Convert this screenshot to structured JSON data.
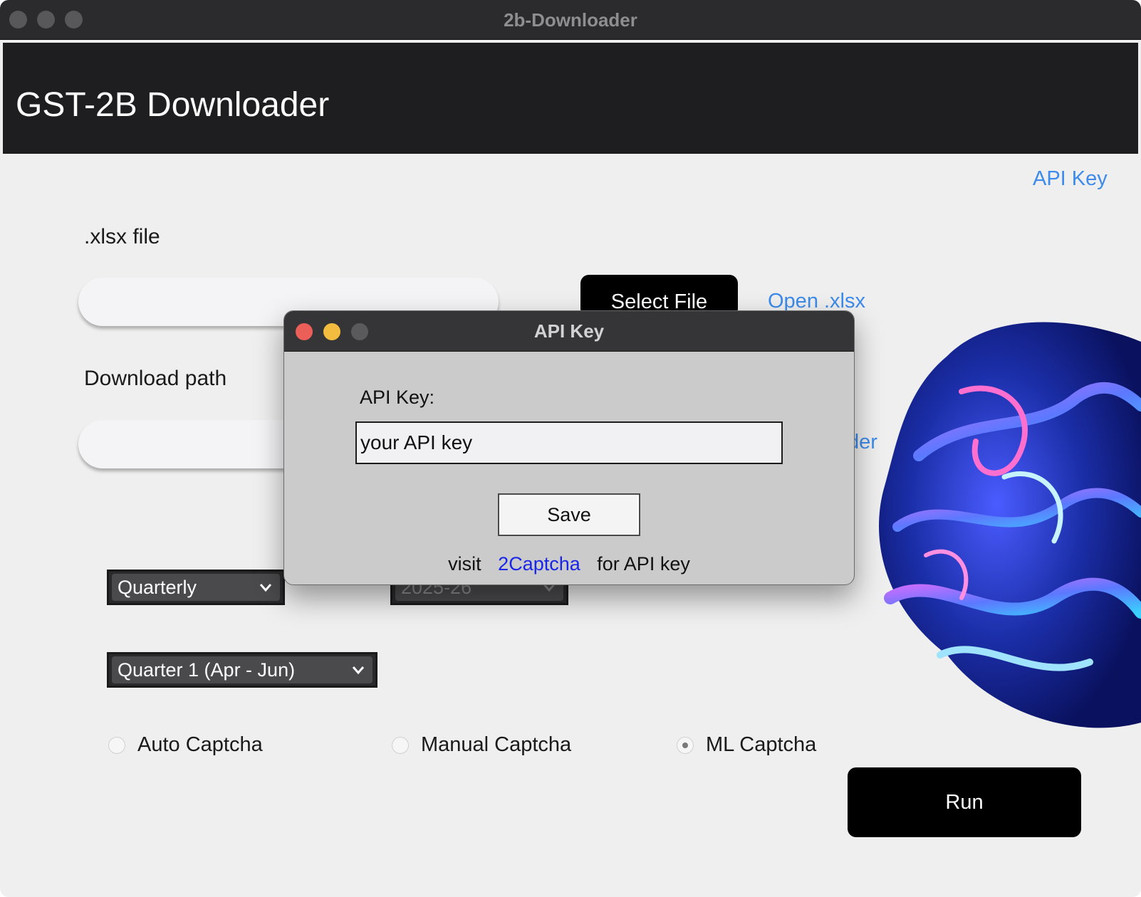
{
  "window": {
    "title": "2b-Downloader"
  },
  "header": {
    "app_title": "GST-2B Downloader"
  },
  "top_link": "API Key",
  "xlsx": {
    "label": ".xlsx file",
    "input_value": "",
    "select_button": "Select File",
    "open_link": "Open .xlsx"
  },
  "download": {
    "label": "Download path",
    "input_value": "",
    "open_link_partial": "der"
  },
  "selects": {
    "frequency": "Quarterly",
    "year": "2025-26",
    "quarter": "Quarter 1 (Apr - Jun)"
  },
  "captcha": {
    "options": [
      "Auto Captcha",
      "Manual Captcha",
      "ML Captcha"
    ],
    "selected": "ML Captcha"
  },
  "run_button": "Run",
  "dialog": {
    "title": "API Key",
    "field_label": "API Key:",
    "input_value": "your API key",
    "save_label": "Save",
    "footer_prefix": "visit",
    "footer_link": "2Captcha",
    "footer_suffix": "for API key"
  },
  "colors": {
    "link": "#3d8bea",
    "dialog_link": "#1a26e6",
    "header_bg": "#1e1e20",
    "close": "#ec5f58",
    "minimize": "#f3bc3e",
    "zoom_disabled": "#5a5a5c"
  }
}
